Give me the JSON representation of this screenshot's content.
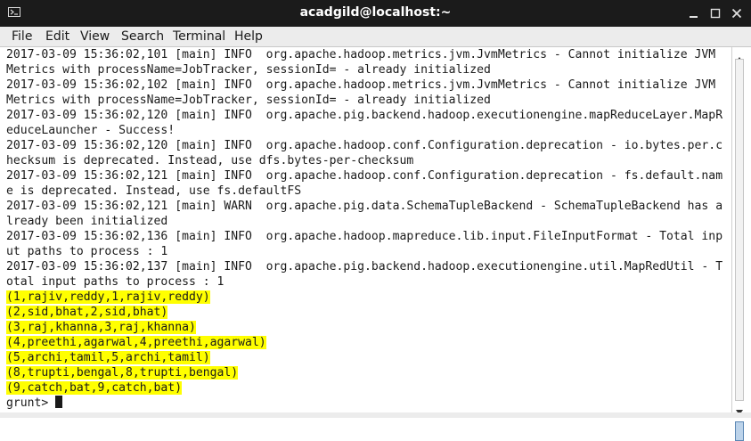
{
  "window": {
    "title": "acadgild@localhost:~"
  },
  "menu": [
    "File",
    "Edit",
    "View",
    "Search",
    "Terminal",
    "Help"
  ],
  "terminal": {
    "log_lines": [
      "2017-03-09 15:36:02,101 [main] INFO  org.apache.hadoop.metrics.jvm.JvmMetrics - Cannot initialize JVM",
      "Metrics with processName=JobTracker, sessionId= - already initialized",
      "2017-03-09 15:36:02,102 [main] INFO  org.apache.hadoop.metrics.jvm.JvmMetrics - Cannot initialize JVM",
      "Metrics with processName=JobTracker, sessionId= - already initialized",
      "2017-03-09 15:36:02,120 [main] INFO  org.apache.pig.backend.hadoop.executionengine.mapReduceLayer.MapR",
      "educeLauncher - Success!",
      "2017-03-09 15:36:02,120 [main] INFO  org.apache.hadoop.conf.Configuration.deprecation - io.bytes.per.c",
      "hecksum is deprecated. Instead, use dfs.bytes-per-checksum",
      "2017-03-09 15:36:02,121 [main] INFO  org.apache.hadoop.conf.Configuration.deprecation - fs.default.nam",
      "e is deprecated. Instead, use fs.defaultFS",
      "2017-03-09 15:36:02,121 [main] WARN  org.apache.pig.data.SchemaTupleBackend - SchemaTupleBackend has a",
      "lready been initialized",
      "2017-03-09 15:36:02,136 [main] INFO  org.apache.hadoop.mapreduce.lib.input.FileInputFormat - Total inp",
      "ut paths to process : 1",
      "2017-03-09 15:36:02,137 [main] INFO  org.apache.pig.backend.hadoop.executionengine.util.MapRedUtil - T",
      "otal input paths to process : 1"
    ],
    "result_lines": [
      "(1,rajiv,reddy,1,rajiv,reddy)",
      "(2,sid,bhat,2,sid,bhat)",
      "(3,raj,khanna,3,raj,khanna)",
      "(4,preethi,agarwal,4,preethi,agarwal)",
      "(5,archi,tamil,5,archi,tamil)",
      "(8,trupti,bengal,8,trupti,bengal)",
      "(9,catch,bat,9,catch,bat)"
    ],
    "prompt": "grunt> ",
    "highlight_color": "#ffff00"
  },
  "icons": {
    "window": "terminal-icon",
    "minimize": "minimize-icon",
    "maximize": "maximize-icon",
    "close": "close-icon",
    "scroll_up": "scroll-up-arrow-icon",
    "scroll_down": "scroll-down-arrow-icon"
  }
}
